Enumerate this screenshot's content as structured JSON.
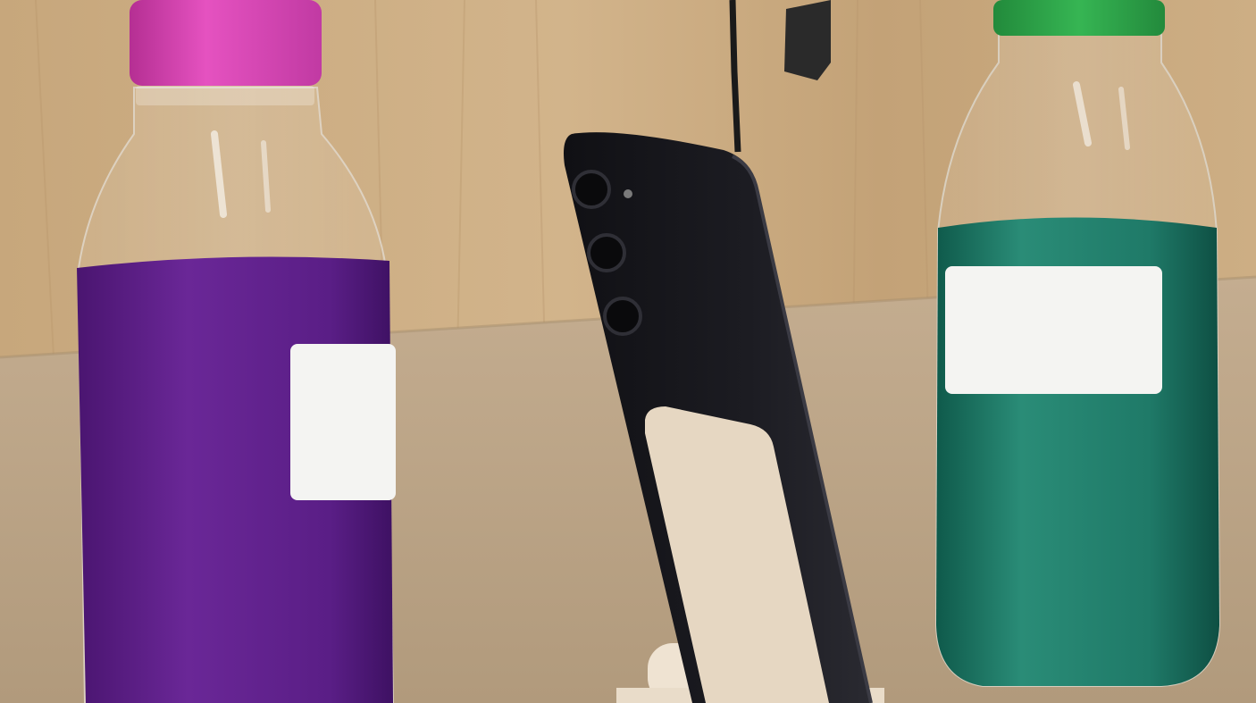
{
  "scene": {
    "colors": {
      "wall": "#c9a97f",
      "wall_dark": "#a88a63",
      "table": "#b8a184",
      "table_light": "#cdb799",
      "purple_liquid": "#5a1e86",
      "purple_dark": "#3e1163",
      "magenta_cap": "#d83fb4",
      "teal_liquid": "#1f7a68",
      "teal_dark": "#0f5a4b",
      "green_cap": "#2fa24a",
      "label_white": "#f4f4f2",
      "phone_body": "#17171b",
      "stand_beige": "#e6d7c2",
      "cable": "#1a1a1a"
    },
    "objects": [
      {
        "name": "bottle-purple",
        "cap_icon": "magenta-cap"
      },
      {
        "name": "phone-on-stand",
        "camera_count": 3
      },
      {
        "name": "bottle-teal",
        "cap_icon": "green-cap"
      }
    ]
  }
}
